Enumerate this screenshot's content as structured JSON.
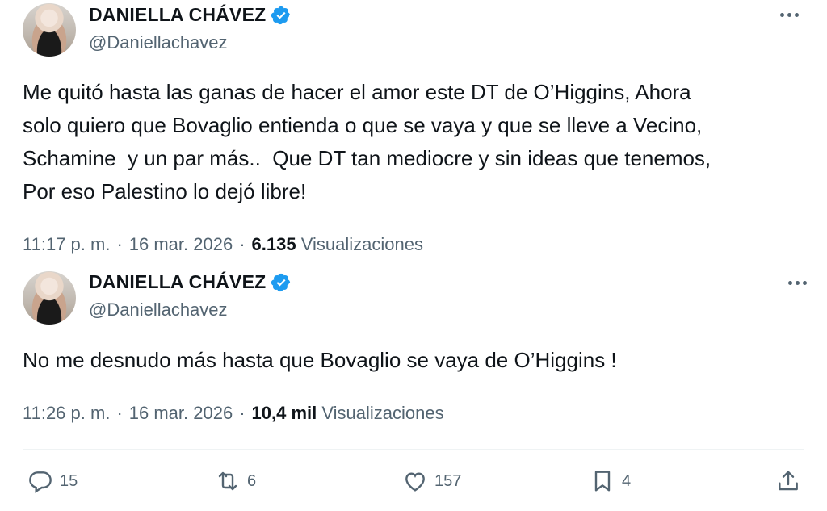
{
  "tweets": [
    {
      "display_name": "DANIELLA CHÁVEZ",
      "handle": "@Daniellachavez",
      "text": "Me quitó hasta las ganas de hacer el amor este DT de O’Higgins, Ahora\nsolo quiero que Bovaglio entienda o que se vaya y que se lleve a Vecino,\nSchamine  y un par más..  Que DT tan mediocre y sin ideas que tenemos,\nPor eso Palestino lo dejó libre!",
      "time": "11:17 p. m.",
      "date": "16 mar. 2026",
      "views_count": "6.135",
      "views_label": "Visualizaciones",
      "separator": "·"
    },
    {
      "display_name": "DANIELLA CHÁVEZ",
      "handle": "@Daniellachavez",
      "text": "No me desnudo más hasta que Bovaglio se vaya de O’Higgins !",
      "time": "11:26 p. m.",
      "date": "16 mar. 2026",
      "views_count": "10,4 mil",
      "views_label": "Visualizaciones",
      "separator": "·"
    }
  ],
  "actions": {
    "reply_count": "15",
    "retweet_count": "6",
    "like_count": "157",
    "bookmark_count": "4"
  },
  "icons": {
    "verified": "verified-badge-icon",
    "more": "more-horizontal-icon",
    "reply": "reply-icon",
    "retweet": "retweet-icon",
    "like": "heart-icon",
    "bookmark": "bookmark-icon",
    "share": "share-icon"
  },
  "colors": {
    "verified_blue": "#1d9bf0",
    "secondary_text": "#536471",
    "primary_text": "#0f1419"
  }
}
